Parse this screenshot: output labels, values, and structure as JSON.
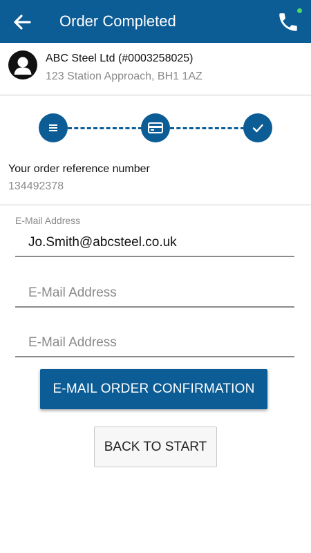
{
  "appbar": {
    "title": "Order Completed",
    "back_icon": "back-arrow-icon",
    "phone_icon": "phone-icon",
    "status_dot_color": "#4cd964",
    "color": "#0c5c96"
  },
  "customer": {
    "name": "ABC Steel Ltd (#0003258025)",
    "address": "123 Station Approach, BH1 1AZ",
    "avatar_icon": "person-icon"
  },
  "stepper": {
    "steps": [
      {
        "icon": "list-icon",
        "state": "completed"
      },
      {
        "icon": "card-icon",
        "state": "completed"
      },
      {
        "icon": "check-icon",
        "state": "completed"
      }
    ]
  },
  "order": {
    "reference_label": "Your order reference number",
    "reference_number": "134492378"
  },
  "email": {
    "label": "E-Mail Address",
    "fields": [
      {
        "value": "Jo.Smith@abcsteel.co.uk",
        "placeholder": "E-Mail Address"
      },
      {
        "value": "",
        "placeholder": "E-Mail Address"
      },
      {
        "value": "",
        "placeholder": "E-Mail Address"
      }
    ]
  },
  "actions": {
    "email_confirmation": "E-MAIL ORDER CONFIRMATION",
    "back_to_start": "BACK TO START"
  }
}
